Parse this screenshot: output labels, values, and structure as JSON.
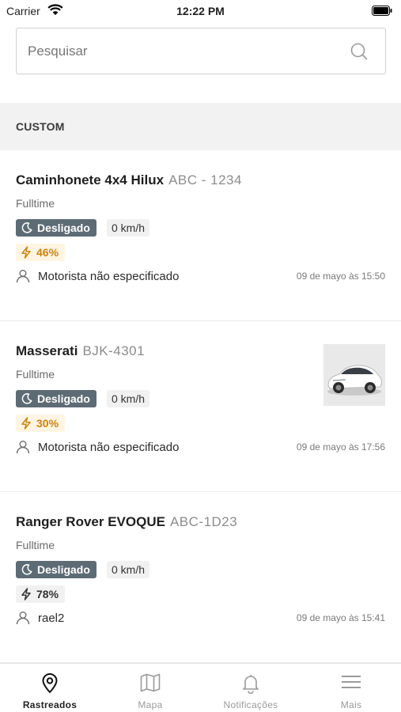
{
  "status_bar": {
    "carrier": "Carrier",
    "time": "12:22 PM"
  },
  "search": {
    "placeholder": "Pesquisar"
  },
  "section": {
    "title": "CUSTOM"
  },
  "vehicles": [
    {
      "name": "Caminhonete 4x4 Hilux",
      "plate": "ABC - 1234",
      "mode": "Fulltime",
      "status": "Desligado",
      "speed": "0 km/h",
      "battery": "46%",
      "driver": "Motorista não especificado",
      "timestamp": "09 de mayo às 15:50"
    },
    {
      "name": "Masserati",
      "plate": "BJK-4301",
      "mode": "Fulltime",
      "status": "Desligado",
      "speed": "0 km/h",
      "battery": "30%",
      "driver": "Motorista não especificado",
      "timestamp": "09 de mayo às 17:56"
    },
    {
      "name": "Ranger Rover EVOQUE",
      "plate": "ABC-1D23",
      "mode": "Fulltime",
      "status": "Desligado",
      "speed": "0 km/h",
      "battery": "78%",
      "driver": "rael2",
      "timestamp": "09 de mayo às 15:41"
    }
  ],
  "tabs": [
    {
      "label": "Rastreados",
      "icon": "location-pin-icon",
      "active": true
    },
    {
      "label": "Mapa",
      "icon": "map-icon",
      "active": false
    },
    {
      "label": "Notificações",
      "icon": "bell-icon",
      "active": false
    },
    {
      "label": "Mais",
      "icon": "menu-icon",
      "active": false
    }
  ],
  "colors": {
    "status_pill": "#5d6b75",
    "battery_warning_bg": "#fff5e2",
    "battery_warning_text": "#c98512"
  }
}
